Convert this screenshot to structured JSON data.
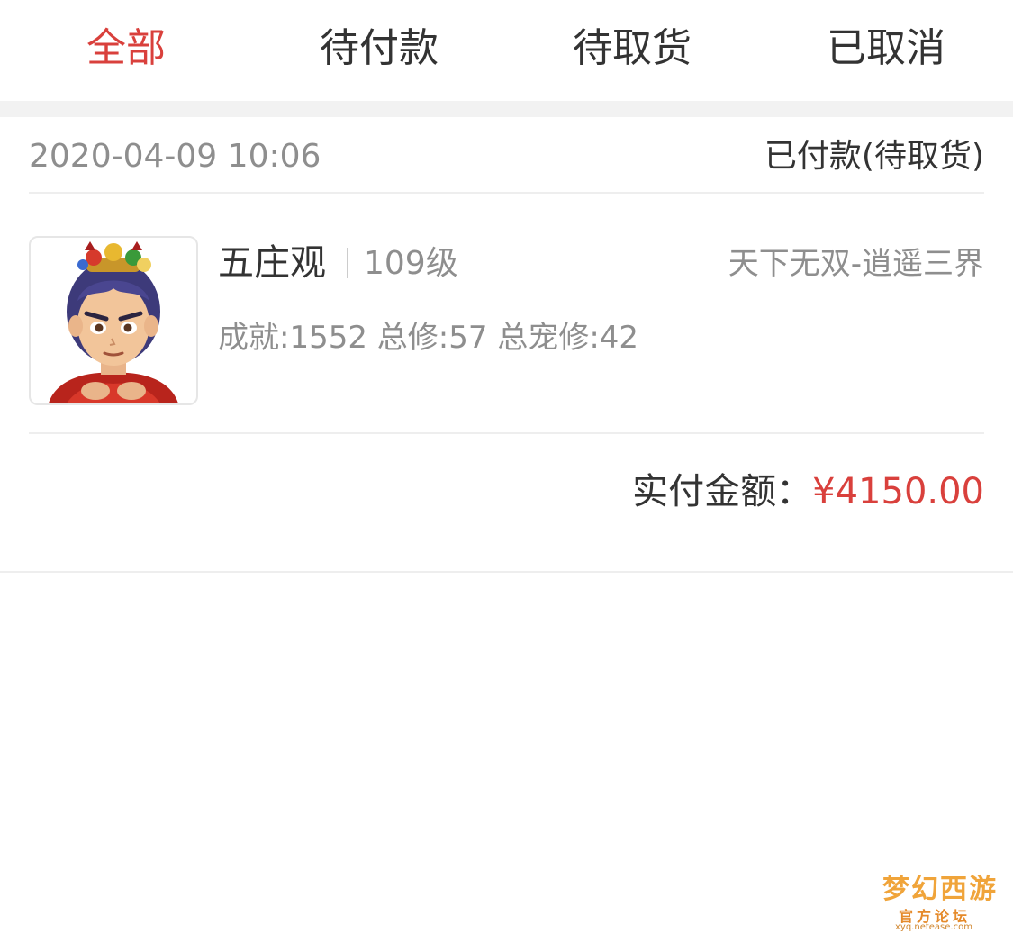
{
  "tabs": [
    {
      "label": "全部",
      "active": true
    },
    {
      "label": "待付款",
      "active": false
    },
    {
      "label": "待取货",
      "active": false
    },
    {
      "label": "已取消",
      "active": false
    }
  ],
  "order": {
    "date": "2020-04-09 10:06",
    "status": "已付款(待取货)",
    "item": {
      "thumbnail_icon": "character-avatar-icon",
      "name": "五庄观",
      "level": "109级",
      "server": "天下无双-逍遥三界",
      "stats": "成就:1552 总修:57 总宠修:42"
    },
    "total_label": "实付金额：",
    "total_amount": "¥4150.00"
  },
  "watermark": {
    "title": "梦幻西游",
    "subtitle": "官方论坛",
    "url": "xyq.netease.com"
  },
  "colors": {
    "accent": "#d9403c",
    "text_primary": "#333333",
    "text_secondary": "#8e8e8e",
    "divider": "#eeeeee"
  }
}
